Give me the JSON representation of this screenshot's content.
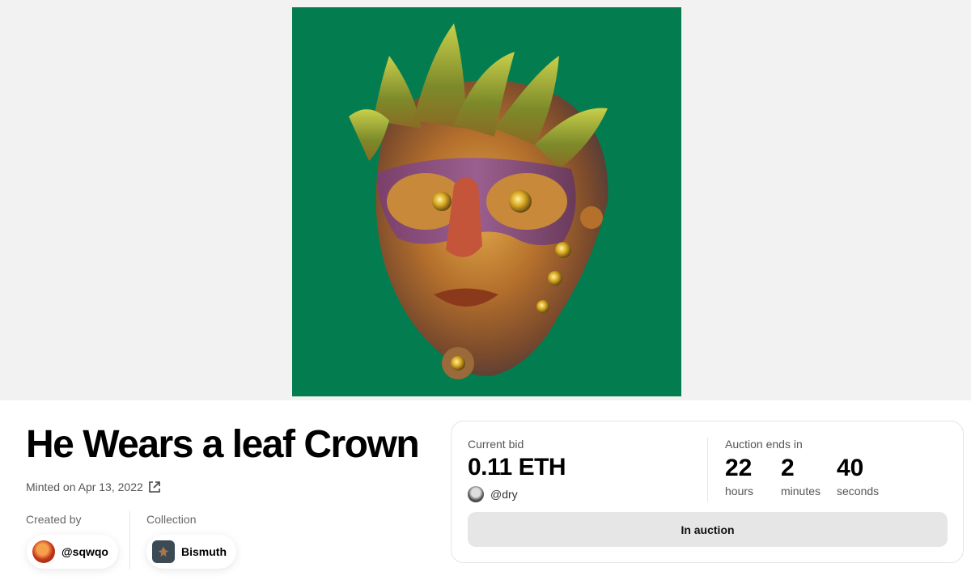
{
  "artwork": {
    "background_color": "#037c4f",
    "subject": "metallic-mask-head-with-leaf-crown"
  },
  "nft": {
    "title": "He Wears a leaf Crown",
    "minted_text": "Minted on Apr 13, 2022",
    "external_link_icon": "external-link-icon"
  },
  "creator": {
    "label": "Created by",
    "handle": "@sqwqo"
  },
  "collection": {
    "label": "Collection",
    "name": "Bismuth"
  },
  "auction": {
    "current_bid_label": "Current bid",
    "current_bid_value": "0.11 ETH",
    "bidder_handle": "@dry",
    "ends_label": "Auction ends in",
    "timer": {
      "hours_value": "22",
      "hours_label": "hours",
      "minutes_value": "2",
      "minutes_label": "minutes",
      "seconds_value": "40",
      "seconds_label": "seconds"
    },
    "status_button_label": "In auction"
  }
}
